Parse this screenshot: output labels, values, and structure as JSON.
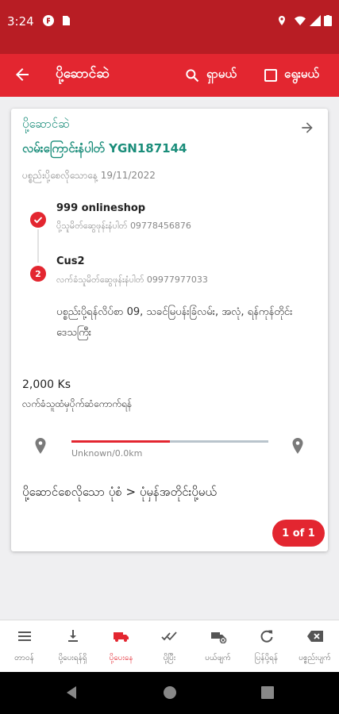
{
  "status_bar": {
    "time": "3:24"
  },
  "app_bar": {
    "title": "ပို့ဆောင်ဆဲ",
    "search_label": "ရှာမယ်",
    "select_label": "ရွေးမယ်"
  },
  "card": {
    "status": "ပို့ဆောင်ဆဲ",
    "tracking_label": "လမ်းကြောင်းနံပါတ်",
    "tracking_id": "YGN187144",
    "created_label": "ပစ္စည်းပို့စေလိုသောနေ့",
    "created_date": "19/11/2022",
    "sender": {
      "name": "999 onlineshop",
      "phone_label": "ပို့သူမိတ်ဆွေဖုန်းနံပါတ်",
      "phone": "09778456876"
    },
    "receiver": {
      "step": "2",
      "name": "Cus2",
      "phone_label": "လက်ခံသူမိတ်ဆွေဖုန်းနံပါတ်",
      "phone": "09977977033",
      "address": "ပစ္စည်းပို့ရန်လိပ်စာ 09, သခင်မြပန်းခြံလမ်း, အလုံ, ရန်ကုန်တိုင်းဒေသကြီး"
    },
    "amount": "2,000 Ks",
    "collect_note": "လက်ခံသူထံမှပိုက်ဆံကောက်ရန်",
    "distance": "Unknown/0.0km",
    "progress": 0.5,
    "service": "ပို့ဆောင်စေလိုသော ပုံစံ > ပုံမှန်အတိုင်းပို့မယ်",
    "pager": "1 of 1"
  },
  "bottom_nav": [
    {
      "label": "တာဝန်",
      "icon": "list-icon",
      "active": false
    },
    {
      "label": "ပို့ပေးရန်ရှိ",
      "icon": "download-icon",
      "active": false
    },
    {
      "label": "ပို့ပေးနေ",
      "icon": "truck-icon",
      "active": true
    },
    {
      "label": "ပို့ပြီး",
      "icon": "double-check-icon",
      "active": false
    },
    {
      "label": "ပယ်ဖျက်",
      "icon": "cancel-truck-icon",
      "active": false
    },
    {
      "label": "ပြန်ပို့ရန်",
      "icon": "refresh-icon",
      "active": false
    },
    {
      "label": "ပစ္စည်းပျက်",
      "icon": "backspace-icon",
      "active": false
    }
  ],
  "colors": {
    "primary": "#e32630",
    "status_bar": "#b81d24",
    "accent_green": "#1a8d7a"
  }
}
